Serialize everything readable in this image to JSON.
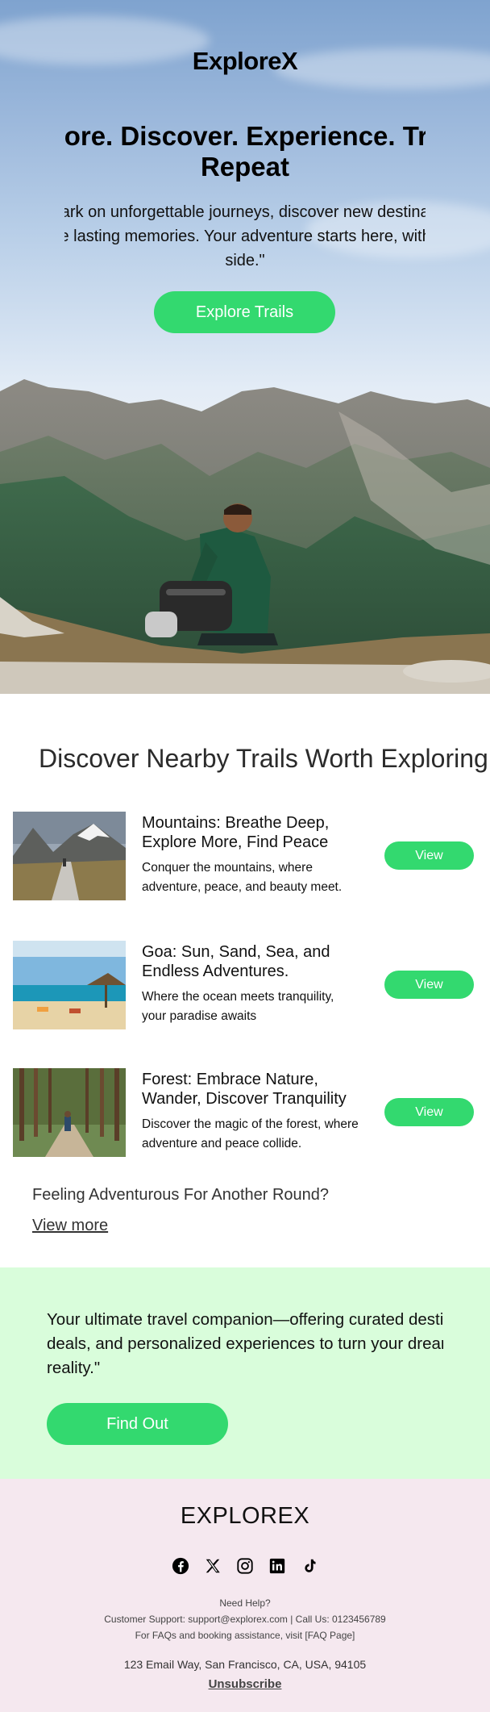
{
  "hero": {
    "brand": "ExploreX",
    "headline_line1": "Explore. Discover. Experience. Travel.",
    "headline_line2": "Repeat",
    "sub_line1": "\"Embark on unforgettable journeys, discover new destinations,",
    "sub_line2": "create lasting memories. Your adventure starts here, with us by your",
    "sub_line3": "side.\"",
    "cta_label": "Explore Trails"
  },
  "trails": {
    "section_title": "Discover Nearby Trails Worth Exploring",
    "items": [
      {
        "title": "Mountains: Breathe Deep, Explore More, Find Peace",
        "description": "Conquer the mountains, where adventure, peace, and beauty meet.",
        "button": "View"
      },
      {
        "title": "Goa: Sun, Sand, Sea, and Endless Adventures.",
        "description": "Where the ocean meets tranquility, your paradise awaits",
        "button": "View"
      },
      {
        "title": "Forest: Embrace Nature, Wander, Discover Tranquility",
        "description": "Discover the magic of the forest, where adventure and peace collide.",
        "button": "View"
      }
    ],
    "more_question": "Feeling Adventurous For Another Round?",
    "more_link": "View more"
  },
  "promo": {
    "line1": "Your ultimate travel companion—offering curated destinations, exclusive",
    "line2": "deals, and personalized experiences to turn your dreams into",
    "line3": "reality.\"",
    "button": "Find Out"
  },
  "footer": {
    "logo": "EXPLOREX",
    "socials": [
      "facebook-icon",
      "x-icon",
      "instagram-icon",
      "linkedin-icon",
      "tiktok-icon"
    ],
    "need_help": "Need Help?",
    "support": "Customer Support: support@explorex.com | Call Us: 0123456789",
    "faq": "For FAQs and booking assistance, visit [FAQ Page]",
    "address": "123 Email Way, San Francisco, CA, USA, 94105",
    "unsubscribe": "Unsubscribe"
  },
  "colors": {
    "accent_green": "#33d96f",
    "promo_bg": "#d9fddb",
    "footer_bg": "#f5e8ef"
  }
}
